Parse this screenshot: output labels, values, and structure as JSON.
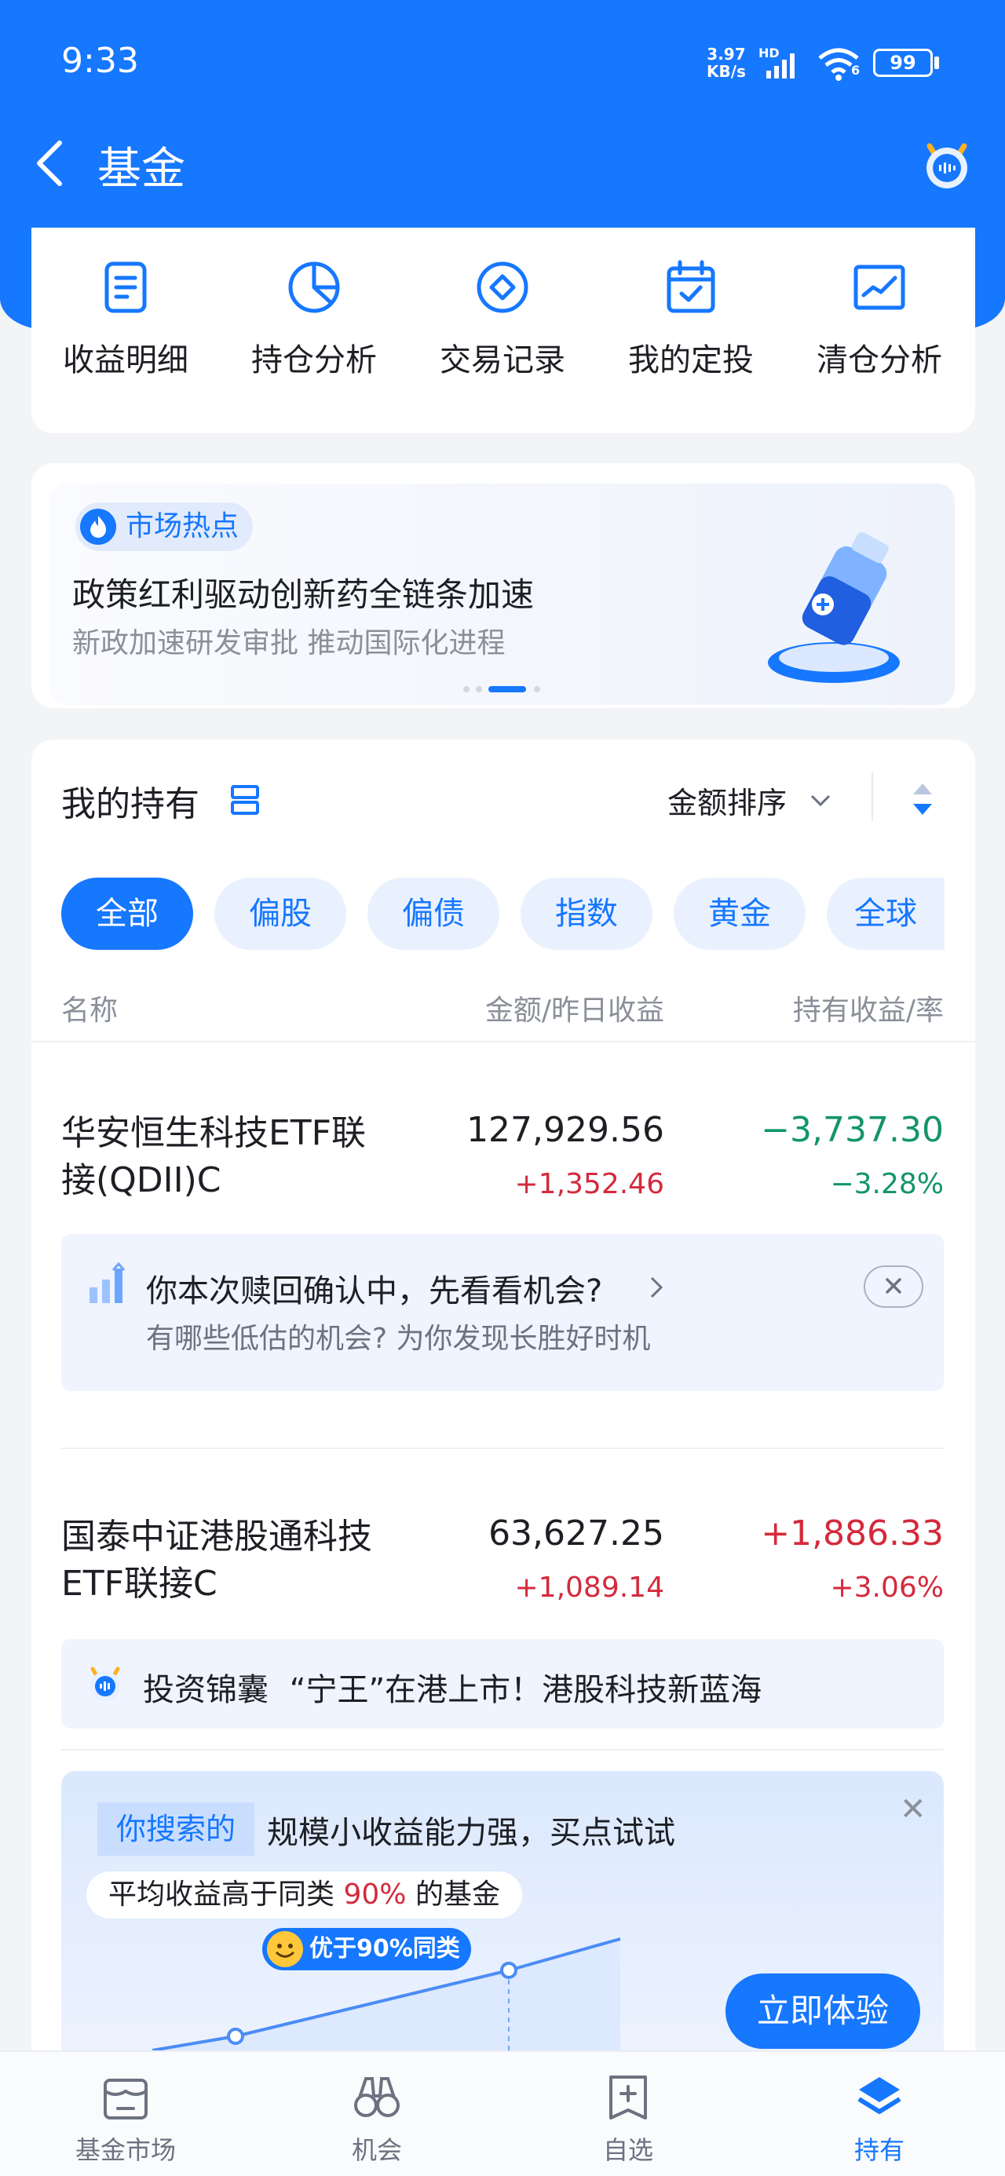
{
  "status": {
    "time": "9:33",
    "net_speed": "3.97",
    "net_unit": "KB/s",
    "hd": "HD",
    "battery": "99",
    "wifi_badge": "6"
  },
  "header": {
    "title": "基金"
  },
  "quick_actions": [
    {
      "label": "收益明细",
      "icon": "document-icon"
    },
    {
      "label": "持仓分析",
      "icon": "pie-chart-icon"
    },
    {
      "label": "交易记录",
      "icon": "diamond-circle-icon"
    },
    {
      "label": "我的定投",
      "icon": "calendar-check-icon"
    },
    {
      "label": "清仓分析",
      "icon": "trend-chart-icon"
    }
  ],
  "banner": {
    "tag": "市场热点",
    "title": "政策红利驱动创新药全链条加速",
    "subtitle": "新政加速研发审批 推动国际化进程"
  },
  "holdings": {
    "title": "我的持有",
    "sort_label": "金额排序",
    "filters": [
      "全部",
      "偏股",
      "偏债",
      "指数",
      "黄金",
      "全球"
    ],
    "active_filter": "全部",
    "col_name": "名称",
    "col_amount": "金额/昨日收益",
    "col_profit": "持有收益/率",
    "funds": [
      {
        "name_line1": "华安恒生科技ETF联",
        "name_line2": "接(QDII)C",
        "amount": "127,929.56",
        "yesterday": "+1,352.46",
        "profit": "−3,737.30",
        "rate": "−3.28%"
      },
      {
        "name_line1": "国泰中证港股通科技",
        "name_line2": "ETF联接C",
        "amount": "63,627.25",
        "yesterday": "+1,089.14",
        "profit": "+1,886.33",
        "rate": "+3.06%"
      }
    ],
    "redeem_tip": {
      "title": "你本次赎回确认中，先看看机会?",
      "subtitle": "有哪些低估的机会? 为你发现长胜好时机"
    },
    "jinnang": {
      "label": "投资锦囊",
      "text": "“宁王”在港上市！港股科技新蓝海"
    }
  },
  "promo": {
    "tag": "你搜索的",
    "title": "规模小收益能力强，买点试试",
    "badge_prefix": "平均收益高于同类",
    "badge_value": "90%",
    "badge_suffix": "的基金",
    "bubble": "优于90%同类",
    "cta": "立即体验"
  },
  "tabs": [
    {
      "label": "基金市场",
      "icon": "market-icon"
    },
    {
      "label": "机会",
      "icon": "binoculars-icon"
    },
    {
      "label": "自选",
      "icon": "add-watchlist-icon"
    },
    {
      "label": "持有",
      "icon": "layers-icon",
      "active": true
    }
  ],
  "colors": {
    "brand": "#1677ff",
    "rise": "#d42a3c",
    "fall": "#13946c"
  }
}
